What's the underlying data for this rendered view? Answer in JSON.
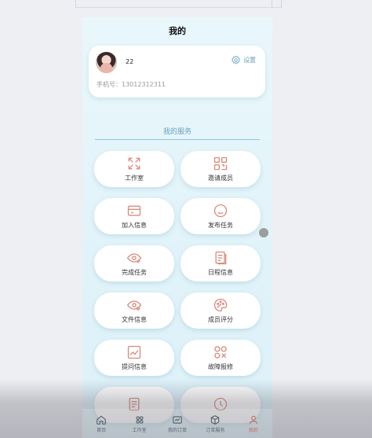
{
  "page": {
    "title": "我的"
  },
  "profile": {
    "name": "22",
    "settings_label": "设置",
    "phone_label": "手机号：13012312311"
  },
  "services": {
    "title": "我的服务",
    "items": [
      {
        "label": "工作室",
        "icon": "expand-icon"
      },
      {
        "label": "邀请成员",
        "icon": "qr-grid-icon"
      },
      {
        "label": "加入信息",
        "icon": "card-icon"
      },
      {
        "label": "发布任务",
        "icon": "chat-bubble-icon"
      },
      {
        "label": "完成任务",
        "icon": "eye-check-icon"
      },
      {
        "label": "日程信息",
        "icon": "document-icon"
      },
      {
        "label": "文件信息",
        "icon": "eye-heart-icon"
      },
      {
        "label": "成员评分",
        "icon": "palette-icon"
      },
      {
        "label": "提问信息",
        "icon": "chart-icon"
      },
      {
        "label": "故障报修",
        "icon": "wrench-circles-icon"
      },
      {
        "label": "",
        "icon": "list-icon"
      },
      {
        "label": "",
        "icon": "clock-icon"
      }
    ]
  },
  "tabbar": {
    "items": [
      {
        "label": "首页",
        "icon": "home-icon"
      },
      {
        "label": "工作室",
        "icon": "studio-icon"
      },
      {
        "label": "我的订单",
        "icon": "order-icon"
      },
      {
        "label": "订单服务",
        "icon": "box-icon"
      },
      {
        "label": "我的",
        "icon": "person-icon"
      }
    ],
    "active_index": 4
  },
  "colors": {
    "accent": "#d88b7c",
    "secondary": "#6aa3be",
    "background": "#e6f5fa"
  }
}
